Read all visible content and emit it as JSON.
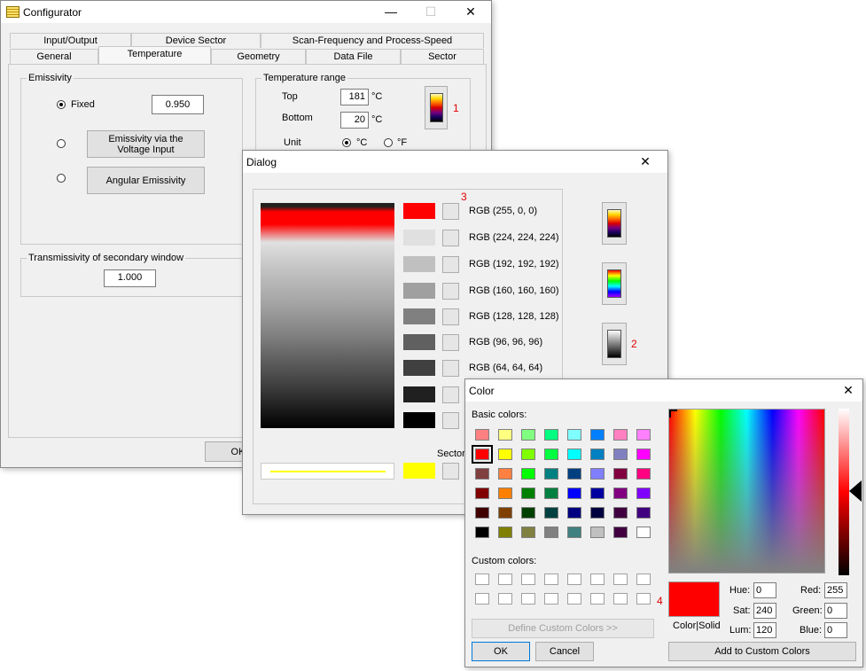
{
  "configurator": {
    "title": "Configurator",
    "tabs_row1": [
      "Input/Output",
      "Device Sector",
      "Scan-Frequency and Process-Speed"
    ],
    "tabs_row2": [
      "General",
      "Temperature",
      "Geometry",
      "Data File",
      "Sector"
    ],
    "active_tab": "Temperature",
    "emissivity": {
      "group_label": "Emissivity",
      "fixed_label": "Fixed",
      "fixed_value": "0.950",
      "voltage_button": "Emissivity via the Voltage Input",
      "angular_button": "Angular Emissivity"
    },
    "transmissivity": {
      "group_label": "Transmissivity of secondary window",
      "value": "1.000"
    },
    "temp_range": {
      "group_label": "Temperature range",
      "top_label": "Top",
      "top_value": "181",
      "bottom_label": "Bottom",
      "bottom_value": "20",
      "unit_c": "°C",
      "unit_label": "Unit",
      "unit_c_option": "°C",
      "unit_f_option": "°F",
      "marker": "1"
    },
    "ok_label": "OK"
  },
  "dialog": {
    "title": "Dialog",
    "marker3": "3",
    "marker2": "2",
    "rows": [
      {
        "label": "RGB (255, 0, 0)",
        "color": "#ff0000"
      },
      {
        "label": "RGB (224, 224, 224)",
        "color": "#e0e0e0"
      },
      {
        "label": "RGB (192, 192, 192)",
        "color": "#c0c0c0"
      },
      {
        "label": "RGB (160, 160, 160)",
        "color": "#a0a0a0"
      },
      {
        "label": "RGB (128, 128, 128)",
        "color": "#808080"
      },
      {
        "label": "RGB (96, 96, 96)",
        "color": "#606060"
      },
      {
        "label": "RGB (64, 64, 64)",
        "color": "#404040"
      },
      {
        "label": "",
        "color": "#202020"
      },
      {
        "label": "",
        "color": "#000000"
      }
    ],
    "sector_label": "Sector",
    "sector_color": "#ffff00"
  },
  "color_dialog": {
    "title": "Color",
    "basic_label": "Basic colors:",
    "custom_label": "Custom colors:",
    "define_button": "Define Custom Colors >>",
    "ok_label": "OK",
    "cancel_label": "Cancel",
    "marker4": "4",
    "preview_label": "Color|Solid",
    "hue_label": "Hue:",
    "hue": "0",
    "sat_label": "Sat:",
    "sat": "240",
    "lum_label": "Lum:",
    "lum": "120",
    "red_label": "Red:",
    "red": "255",
    "green_label": "Green:",
    "green": "0",
    "blue_label": "Blue:",
    "blue": "0",
    "add_button": "Add to Custom Colors",
    "basic_colors": [
      "#ff8080",
      "#ffff80",
      "#80ff80",
      "#00ff80",
      "#80ffff",
      "#0080ff",
      "#ff80c0",
      "#ff80ff",
      "#ff0000",
      "#ffff00",
      "#80ff00",
      "#00ff40",
      "#00ffff",
      "#0080c0",
      "#8080c0",
      "#ff00ff",
      "#804040",
      "#ff8040",
      "#00ff00",
      "#008080",
      "#004080",
      "#8080ff",
      "#800040",
      "#ff0080",
      "#800000",
      "#ff8000",
      "#008000",
      "#008040",
      "#0000ff",
      "#0000a0",
      "#800080",
      "#8000ff",
      "#400000",
      "#804000",
      "#004000",
      "#004040",
      "#000080",
      "#000040",
      "#400040",
      "#400080",
      "#000000",
      "#808000",
      "#808040",
      "#808080",
      "#408080",
      "#c0c0c0",
      "#400040",
      "#ffffff"
    ],
    "selected_index": 8,
    "preview_color": "#ff0000"
  }
}
